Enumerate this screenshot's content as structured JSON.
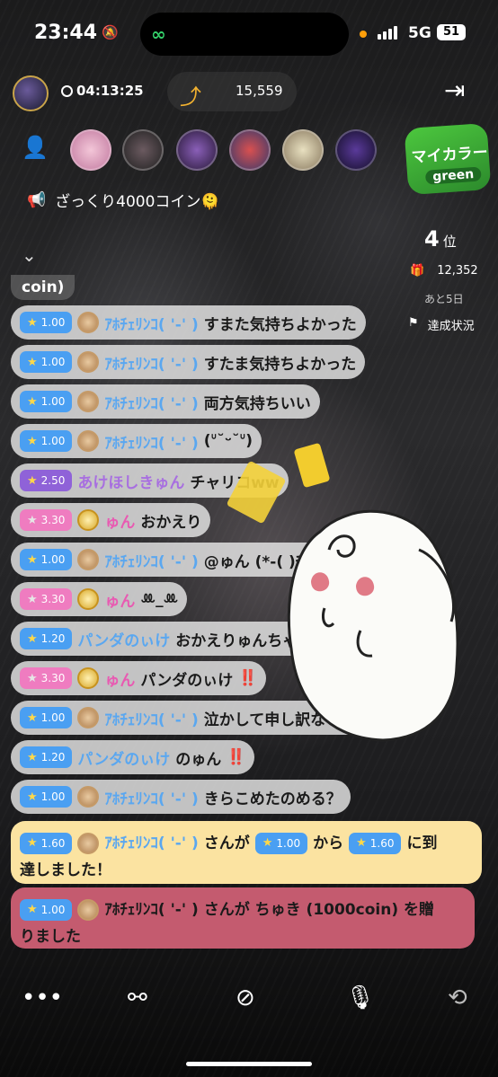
{
  "status_bar": {
    "time": "23:44",
    "network": "5G",
    "battery": "51"
  },
  "header": {
    "timer": "04:13:25",
    "count": "15,559"
  },
  "announcement": "ざっくり4000コイン🫠",
  "badge": {
    "line1": "マイカラー",
    "line2": "green"
  },
  "ranking": {
    "position": "4",
    "unit": "位",
    "gifts": "12,352",
    "days_left": "あと5日",
    "status_label": "達成状況"
  },
  "chat_fragment": "coin)",
  "messages": [
    {
      "level": "1.00",
      "level_color": "blue",
      "medal": "bronze",
      "name": "ｱﾎﾁｪﾘﾝｺ( '-' )",
      "name_color": "blue",
      "text": "すまた気持ちよかった",
      "emphasis": ""
    },
    {
      "level": "1.00",
      "level_color": "blue",
      "medal": "bronze",
      "name": "ｱﾎﾁｪﾘﾝｺ( '-' )",
      "name_color": "blue",
      "text": "すたま気持ちよかった",
      "emphasis": ""
    },
    {
      "level": "1.00",
      "level_color": "blue",
      "medal": "bronze",
      "name": "ｱﾎﾁｪﾘﾝｺ( '-' )",
      "name_color": "blue",
      "text": "両方気持ちいい",
      "emphasis": ""
    },
    {
      "level": "1.00",
      "level_color": "blue",
      "medal": "bronze",
      "name": "ｱﾎﾁｪﾘﾝｺ( '-' )",
      "name_color": "blue",
      "text": "(ᐡ˘ᵕ˘ᐡ)",
      "emphasis": ""
    },
    {
      "level": "2.50",
      "level_color": "purple",
      "medal": "none",
      "name": "あけほしきゅん",
      "name_color": "purple",
      "text": "チャリコww",
      "emphasis": ""
    },
    {
      "level": "3.30",
      "level_color": "pink",
      "medal": "gold",
      "name": "ゅん",
      "name_color": "pink",
      "text": "おかえり",
      "emphasis": ""
    },
    {
      "level": "1.00",
      "level_color": "blue",
      "medal": "bronze",
      "name": "ｱﾎﾁｪﾘﾝｺ( '-' )",
      "name_color": "blue",
      "text": "@ゅん (*-(   )ﾁｭｯ♪",
      "emphasis": ""
    },
    {
      "level": "3.30",
      "level_color": "pink",
      "medal": "gold",
      "name": "ゅん",
      "name_color": "pink",
      "text": "ꔛ_ꔛ",
      "emphasis": ""
    },
    {
      "level": "1.20",
      "level_color": "blue",
      "medal": "none",
      "name": "パンダのぃけ",
      "name_color": "blue",
      "text": "おかえりゅんちゃん",
      "emphasis": ""
    },
    {
      "level": "3.30",
      "level_color": "pink",
      "medal": "gold",
      "name": "ゅん",
      "name_color": "pink",
      "text": "パンダのぃけ",
      "emphasis": "‼️"
    },
    {
      "level": "1.00",
      "level_color": "blue",
      "medal": "bronze",
      "name": "ｱﾎﾁｪﾘﾝｺ( '-' )",
      "name_color": "blue",
      "text": "泣かして申し訳ないから",
      "emphasis": ""
    },
    {
      "level": "1.20",
      "level_color": "blue",
      "medal": "none",
      "name": "パンダのぃけ",
      "name_color": "blue",
      "text": "のゅん",
      "emphasis": "‼️"
    },
    {
      "level": "1.00",
      "level_color": "blue",
      "medal": "bronze",
      "name": "ｱﾎﾁｪﾘﾝｺ( '-' )",
      "name_color": "blue",
      "text": "きらこめたのめる？",
      "emphasis": ""
    }
  ],
  "system_levelup": {
    "level": "1.60",
    "name": "ｱﾎﾁｪﾘﾝｺ( '-' )",
    "t1": "さんが",
    "from": "1.00",
    "t2": "から",
    "to": "1.60",
    "t3": "に到",
    "t4": "達しました！"
  },
  "system_gift": {
    "level": "1.00",
    "name": "ｱﾎﾁｪﾘﾝｺ( '-' )",
    "t1": "さんが ちゅき (1000coin) を贈",
    "t2": "りました"
  },
  "icons": [
    "more-icon",
    "share-icon",
    "camera-off-icon",
    "mic-icon",
    "camera-flip-icon"
  ]
}
